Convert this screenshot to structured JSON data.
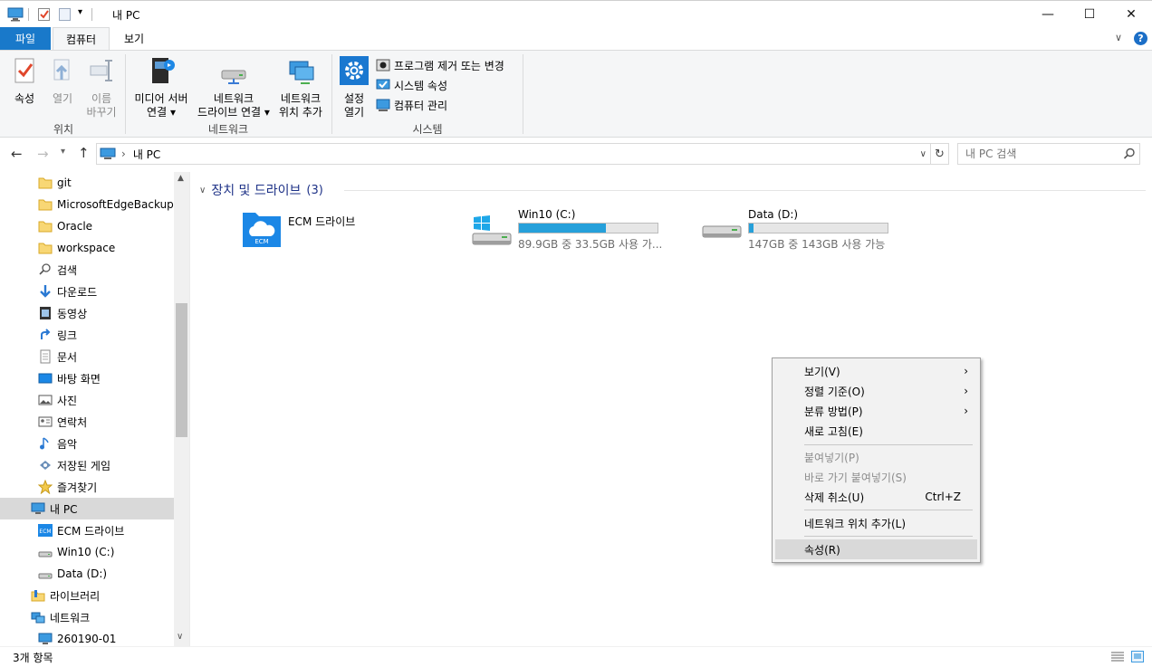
{
  "window": {
    "title": "내 PC",
    "controls": {
      "minimize": "—",
      "maximize": "☐",
      "close": "✕"
    }
  },
  "tabs": [
    {
      "label": "파일"
    },
    {
      "label": "컴퓨터"
    },
    {
      "label": "보기"
    }
  ],
  "ribbon": {
    "location_group": {
      "label": "위치",
      "properties": "속성",
      "open": "열기",
      "rename_1": "이름",
      "rename_2": "바꾸기"
    },
    "network_group": {
      "label": "네트워크",
      "media_1": "미디어 서버",
      "media_2": "연결",
      "map_1": "네트워크",
      "map_2": "드라이브 연결",
      "add_1": "네트워크",
      "add_2": "위치 추가"
    },
    "system_group": {
      "label": "시스템",
      "settings_1": "설정",
      "settings_2": "열기",
      "uninstall": "프로그램 제거 또는 변경",
      "sys_props": "시스템 속성",
      "manage": "컴퓨터 관리"
    }
  },
  "nav": {
    "address": "내 PC",
    "search_placeholder": "내 PC 검색"
  },
  "sidebar": {
    "items": [
      {
        "label": "git",
        "icon": "folder-icon"
      },
      {
        "label": "MicrosoftEdgeBackups",
        "icon": "folder-icon"
      },
      {
        "label": "Oracle",
        "icon": "folder-icon"
      },
      {
        "label": "workspace",
        "icon": "folder-icon"
      },
      {
        "label": "검색",
        "icon": "search-icon"
      },
      {
        "label": "다운로드",
        "icon": "download-icon"
      },
      {
        "label": "동영상",
        "icon": "video-icon"
      },
      {
        "label": "링크",
        "icon": "link-icon"
      },
      {
        "label": "문서",
        "icon": "document-icon"
      },
      {
        "label": "바탕 화면",
        "icon": "desktop-icon"
      },
      {
        "label": "사진",
        "icon": "picture-icon"
      },
      {
        "label": "연락처",
        "icon": "contacts-icon"
      },
      {
        "label": "음악",
        "icon": "music-icon"
      },
      {
        "label": "저장된 게임",
        "icon": "games-icon"
      },
      {
        "label": "즐겨찾기",
        "icon": "star-icon"
      },
      {
        "label": "내 PC",
        "icon": "pc-icon"
      },
      {
        "label": "ECM 드라이브",
        "icon": "ecm-icon"
      },
      {
        "label": "Win10 (C:)",
        "icon": "drive-icon"
      },
      {
        "label": "Data (D:)",
        "icon": "drive-icon"
      },
      {
        "label": "라이브러리",
        "icon": "library-icon"
      },
      {
        "label": "네트워크",
        "icon": "network-icon"
      },
      {
        "label": "260190-01",
        "icon": "monitor-icon"
      }
    ]
  },
  "content": {
    "group_title": "장치 및 드라이브",
    "group_count": "(3)",
    "tiles": [
      {
        "name": "ECM 드라이브",
        "badge": "ECM"
      },
      {
        "name": "Win10 (C:)",
        "sub": "89.9GB 중 33.5GB 사용 가...",
        "fill": 0.63
      },
      {
        "name": "Data (D:)",
        "sub": "147GB 중 143GB 사용 가능",
        "fill": 0.03
      }
    ]
  },
  "status": {
    "text": "3개 항목"
  },
  "context_menu": {
    "items": [
      {
        "label": "보기(V)",
        "submenu": true
      },
      {
        "label": "정렬 기준(O)",
        "submenu": true
      },
      {
        "label": "분류 방법(P)",
        "submenu": true
      },
      {
        "label": "새로 고침(E)"
      },
      {
        "label": "붙여넣기(P)",
        "disabled": true
      },
      {
        "label": "바로 가기 붙여넣기(S)",
        "disabled": true
      },
      {
        "label": "삭제 취소(U)",
        "accel": "Ctrl+Z"
      },
      {
        "label": "네트워크 위치 추가(L)"
      },
      {
        "label": "속성(R)",
        "highlighted": true
      }
    ]
  },
  "colors": {
    "accent": "#1979ca",
    "bar_fill": "#26a0da",
    "header_text": "#1e3287"
  }
}
